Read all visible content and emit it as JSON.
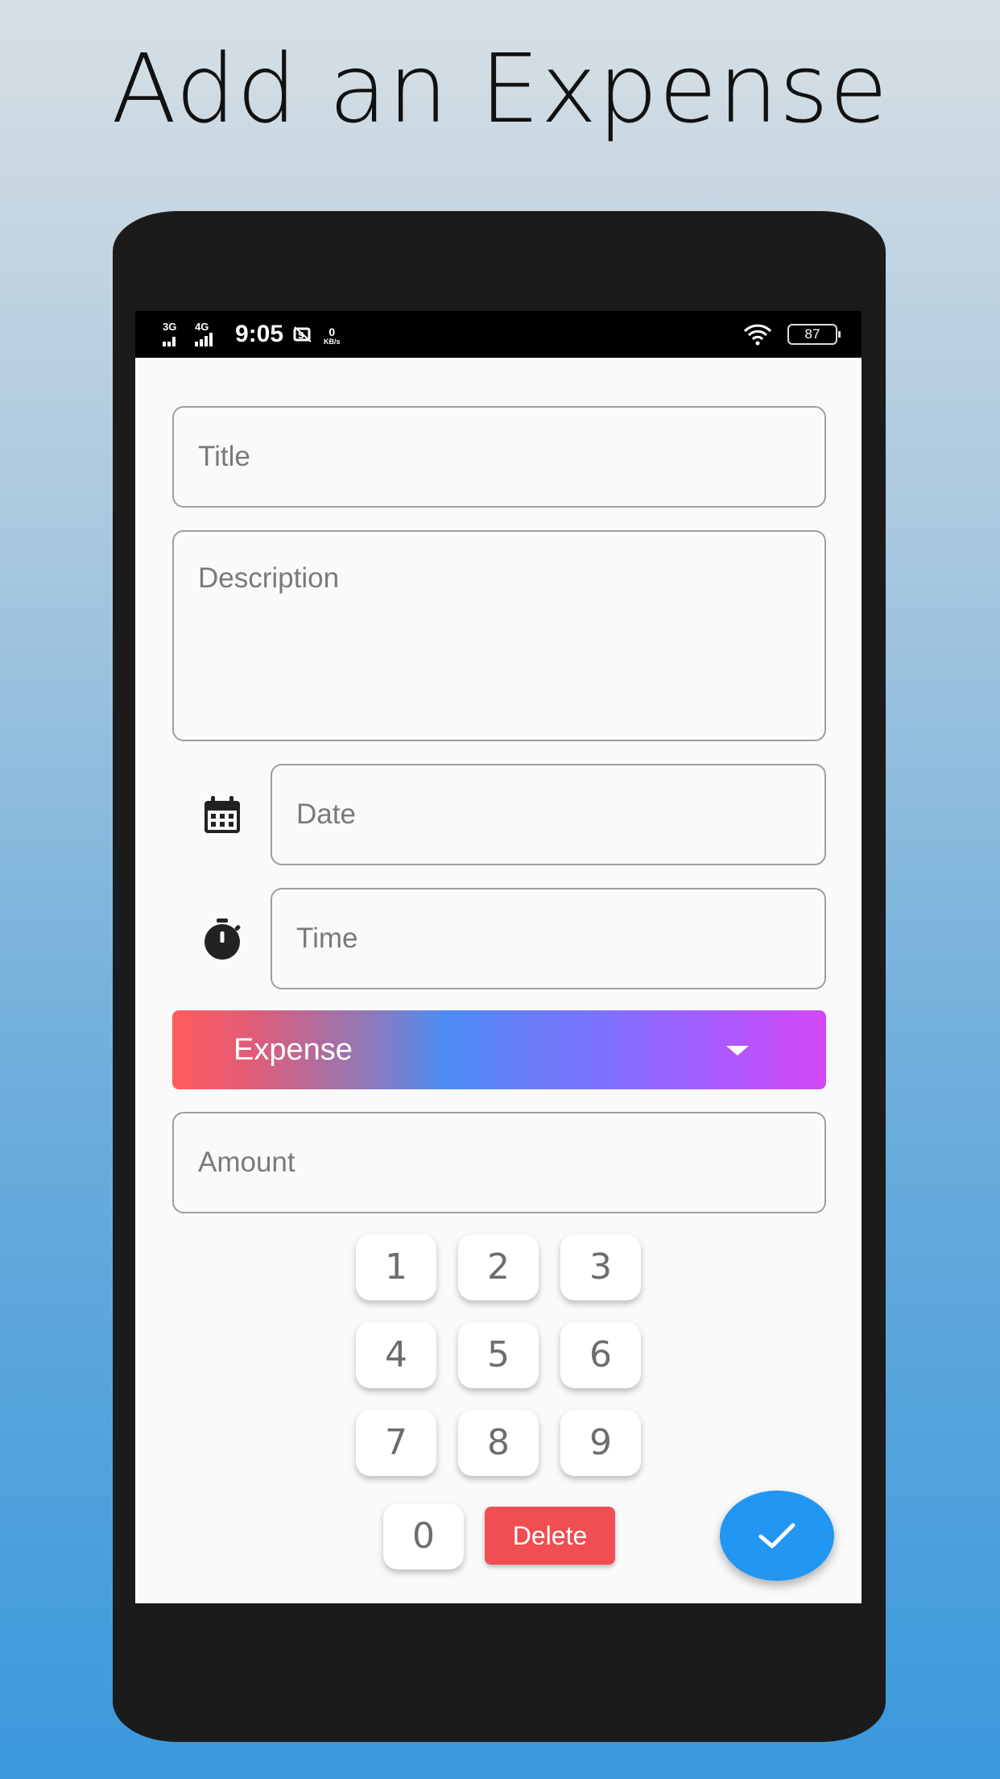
{
  "headline": "Add an Expense",
  "status_bar": {
    "network1": "3G",
    "network2": "4G",
    "time": "9:05",
    "speed_value": "0",
    "speed_unit": "KB/s",
    "battery": "87"
  },
  "form": {
    "title_placeholder": "Title",
    "description_placeholder": "Description",
    "date_placeholder": "Date",
    "time_placeholder": "Time",
    "type_selected": "Expense",
    "amount_placeholder": "Amount"
  },
  "keypad": {
    "k1": "1",
    "k2": "2",
    "k3": "3",
    "k4": "4",
    "k5": "5",
    "k6": "6",
    "k7": "7",
    "k8": "8",
    "k9": "9",
    "k0": "0",
    "delete_label": "Delete"
  },
  "icons": {
    "date": "calendar-icon",
    "time": "stopwatch-icon",
    "submit": "check-icon",
    "dropdown": "caret-down-icon"
  },
  "colors": {
    "fab": "#2196f3",
    "delete": "#f04e52",
    "dropdown_start": "#ff5b5b",
    "dropdown_mid": "#4c8cf5",
    "dropdown_end": "#d447f7"
  }
}
